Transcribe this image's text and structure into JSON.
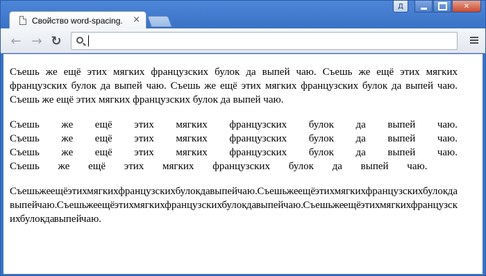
{
  "window": {
    "tab_title": "Свойство word-spacing.",
    "tab_close": "×",
    "lang_indicator": "Д"
  },
  "icons": {
    "tab": "document-icon",
    "back": "arrow-left-icon",
    "forward": "arrow-right-icon",
    "reload": "reload-icon",
    "search": "search-icon",
    "menu": "menu-icon"
  },
  "toolbar": {
    "back_glyph": "←",
    "forward_glyph": "→",
    "reload_glyph": "↻",
    "address_value": ""
  },
  "content": {
    "paragraphs": [
      "Съешь же ещё этих мягких французских булок да выпей чаю. Съешь же ещё этих мягких французских булок да выпей чаю. Съешь же ещё этих мягких французских булок да выпей чаю. Съешь же ещё этих мягких французских булок да выпей чаю.",
      "Съешь же ещё этих мягких французских булок да выпей чаю. Съешь же ещё этих мягких французских булок да выпей чаю. Съешь же ещё этих мягких французских булок да выпей чаю. Съешь же ещё этих мягких французских булок да выпей чаю.",
      "Съешь же ещё этих мягких французских булок да выпей чаю. Съешь же ещё этих мягких французских булок да выпей чаю. Съешь же ещё этих мягких французских булок да выпей чаю. Съешь же ещё этих мягких французских булок да выпей чаю."
    ]
  },
  "colors": {
    "frame": "#3b73c8",
    "page_background": "#ffffff",
    "text": "#000000"
  }
}
